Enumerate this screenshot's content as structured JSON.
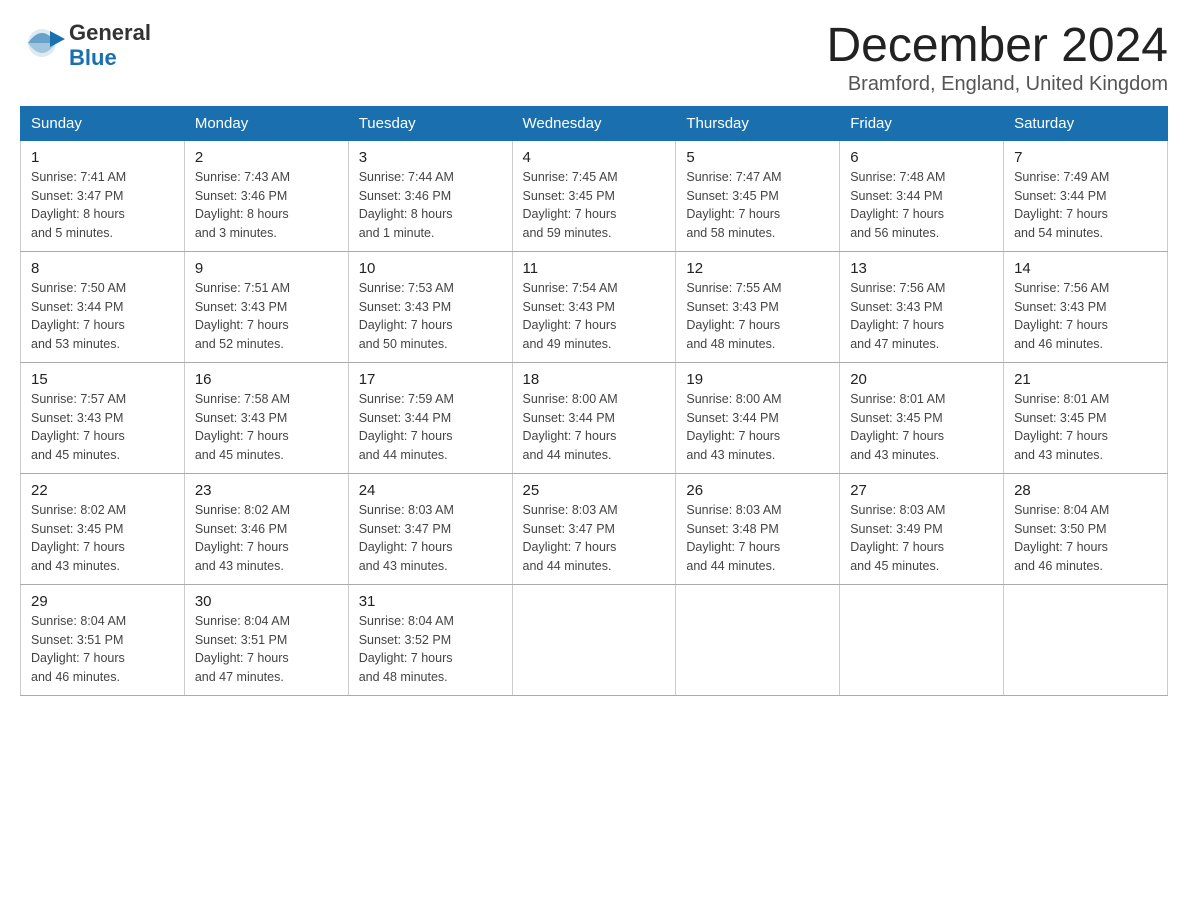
{
  "header": {
    "logo_general": "General",
    "logo_blue": "Blue",
    "month_title": "December 2024",
    "location": "Bramford, England, United Kingdom"
  },
  "days_of_week": [
    "Sunday",
    "Monday",
    "Tuesday",
    "Wednesday",
    "Thursday",
    "Friday",
    "Saturday"
  ],
  "weeks": [
    [
      {
        "day": "1",
        "sunrise": "7:41 AM",
        "sunset": "3:47 PM",
        "daylight": "8 hours and 5 minutes."
      },
      {
        "day": "2",
        "sunrise": "7:43 AM",
        "sunset": "3:46 PM",
        "daylight": "8 hours and 3 minutes."
      },
      {
        "day": "3",
        "sunrise": "7:44 AM",
        "sunset": "3:46 PM",
        "daylight": "8 hours and 1 minute."
      },
      {
        "day": "4",
        "sunrise": "7:45 AM",
        "sunset": "3:45 PM",
        "daylight": "7 hours and 59 minutes."
      },
      {
        "day": "5",
        "sunrise": "7:47 AM",
        "sunset": "3:45 PM",
        "daylight": "7 hours and 58 minutes."
      },
      {
        "day": "6",
        "sunrise": "7:48 AM",
        "sunset": "3:44 PM",
        "daylight": "7 hours and 56 minutes."
      },
      {
        "day": "7",
        "sunrise": "7:49 AM",
        "sunset": "3:44 PM",
        "daylight": "7 hours and 54 minutes."
      }
    ],
    [
      {
        "day": "8",
        "sunrise": "7:50 AM",
        "sunset": "3:44 PM",
        "daylight": "7 hours and 53 minutes."
      },
      {
        "day": "9",
        "sunrise": "7:51 AM",
        "sunset": "3:43 PM",
        "daylight": "7 hours and 52 minutes."
      },
      {
        "day": "10",
        "sunrise": "7:53 AM",
        "sunset": "3:43 PM",
        "daylight": "7 hours and 50 minutes."
      },
      {
        "day": "11",
        "sunrise": "7:54 AM",
        "sunset": "3:43 PM",
        "daylight": "7 hours and 49 minutes."
      },
      {
        "day": "12",
        "sunrise": "7:55 AM",
        "sunset": "3:43 PM",
        "daylight": "7 hours and 48 minutes."
      },
      {
        "day": "13",
        "sunrise": "7:56 AM",
        "sunset": "3:43 PM",
        "daylight": "7 hours and 47 minutes."
      },
      {
        "day": "14",
        "sunrise": "7:56 AM",
        "sunset": "3:43 PM",
        "daylight": "7 hours and 46 minutes."
      }
    ],
    [
      {
        "day": "15",
        "sunrise": "7:57 AM",
        "sunset": "3:43 PM",
        "daylight": "7 hours and 45 minutes."
      },
      {
        "day": "16",
        "sunrise": "7:58 AM",
        "sunset": "3:43 PM",
        "daylight": "7 hours and 45 minutes."
      },
      {
        "day": "17",
        "sunrise": "7:59 AM",
        "sunset": "3:44 PM",
        "daylight": "7 hours and 44 minutes."
      },
      {
        "day": "18",
        "sunrise": "8:00 AM",
        "sunset": "3:44 PM",
        "daylight": "7 hours and 44 minutes."
      },
      {
        "day": "19",
        "sunrise": "8:00 AM",
        "sunset": "3:44 PM",
        "daylight": "7 hours and 43 minutes."
      },
      {
        "day": "20",
        "sunrise": "8:01 AM",
        "sunset": "3:45 PM",
        "daylight": "7 hours and 43 minutes."
      },
      {
        "day": "21",
        "sunrise": "8:01 AM",
        "sunset": "3:45 PM",
        "daylight": "7 hours and 43 minutes."
      }
    ],
    [
      {
        "day": "22",
        "sunrise": "8:02 AM",
        "sunset": "3:45 PM",
        "daylight": "7 hours and 43 minutes."
      },
      {
        "day": "23",
        "sunrise": "8:02 AM",
        "sunset": "3:46 PM",
        "daylight": "7 hours and 43 minutes."
      },
      {
        "day": "24",
        "sunrise": "8:03 AM",
        "sunset": "3:47 PM",
        "daylight": "7 hours and 43 minutes."
      },
      {
        "day": "25",
        "sunrise": "8:03 AM",
        "sunset": "3:47 PM",
        "daylight": "7 hours and 44 minutes."
      },
      {
        "day": "26",
        "sunrise": "8:03 AM",
        "sunset": "3:48 PM",
        "daylight": "7 hours and 44 minutes."
      },
      {
        "day": "27",
        "sunrise": "8:03 AM",
        "sunset": "3:49 PM",
        "daylight": "7 hours and 45 minutes."
      },
      {
        "day": "28",
        "sunrise": "8:04 AM",
        "sunset": "3:50 PM",
        "daylight": "7 hours and 46 minutes."
      }
    ],
    [
      {
        "day": "29",
        "sunrise": "8:04 AM",
        "sunset": "3:51 PM",
        "daylight": "7 hours and 46 minutes."
      },
      {
        "day": "30",
        "sunrise": "8:04 AM",
        "sunset": "3:51 PM",
        "daylight": "7 hours and 47 minutes."
      },
      {
        "day": "31",
        "sunrise": "8:04 AM",
        "sunset": "3:52 PM",
        "daylight": "7 hours and 48 minutes."
      },
      null,
      null,
      null,
      null
    ]
  ],
  "labels": {
    "sunrise": "Sunrise:",
    "sunset": "Sunset:",
    "daylight": "Daylight:"
  }
}
